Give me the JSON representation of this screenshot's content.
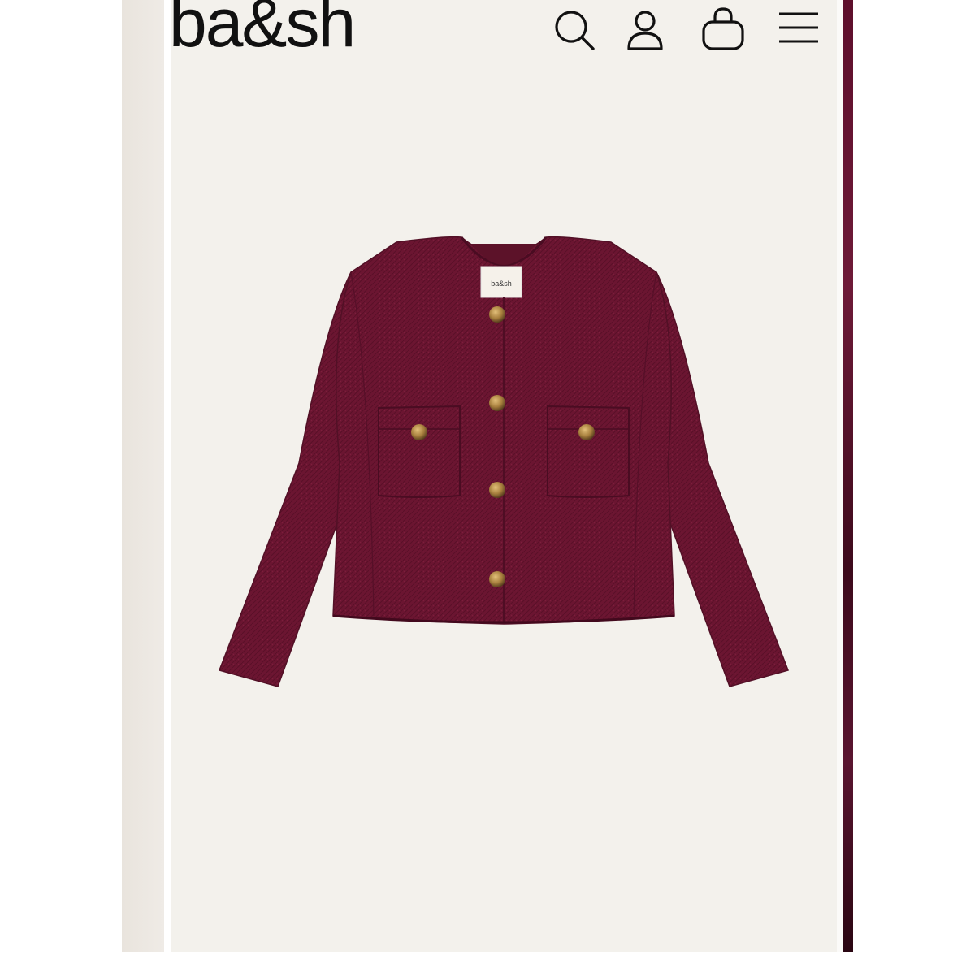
{
  "header": {
    "logo": "ba&sh",
    "icons": [
      "search-icon",
      "account-icon",
      "bag-icon",
      "menu-icon"
    ]
  },
  "product": {
    "label_text": "ba&sh",
    "colors": {
      "fabric": "#6b1531",
      "buttons": "#b08a4a"
    }
  }
}
